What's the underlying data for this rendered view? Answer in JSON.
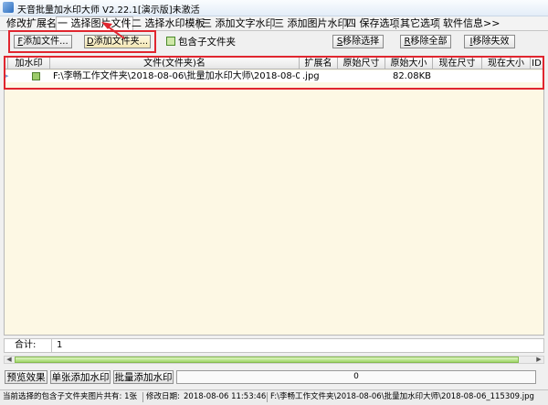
{
  "window": {
    "title": "天音批量加水印大师 V2.22.1[演示版]未激活"
  },
  "tabs": [
    {
      "label": "修改扩展名"
    },
    {
      "label": "一 选择图片文件",
      "active": true
    },
    {
      "label": "二 选择水印模板"
    },
    {
      "label": "三 添加文字水印"
    },
    {
      "label": "三 添加图片水印"
    },
    {
      "label": "四 保存选项"
    },
    {
      "label": "其它选项"
    },
    {
      "label": "软件信息>>"
    }
  ],
  "toolbar": {
    "add_file_key": "F",
    "add_file_label": "添加文件...",
    "add_folder_key": "D",
    "add_folder_label": "添加文件夹...",
    "include_subfolders_label": "包含子文件夹",
    "include_subfolders_checked": true,
    "remove_selected_key": "S",
    "remove_selected_label": "移除选择",
    "remove_all_key": "R",
    "remove_all_label": "移除全部",
    "remove_failed_key": "I",
    "remove_failed_label": "移除失效"
  },
  "grid": {
    "columns": [
      "加水印",
      "文件(文件夹)名",
      "扩展名",
      "原始尺寸",
      "原始大小",
      "现在尺寸",
      "现在大小",
      "ID"
    ],
    "rows": [
      {
        "watermark": true,
        "name": "F:\\李畅工作文件夹\\2018-08-06\\批量加水印大师\\2018-08-06_",
        "ext": ".jpg",
        "orig_dim": "",
        "orig_size": "82.08KB",
        "cur_dim": "",
        "cur_size": "",
        "id": ""
      }
    ]
  },
  "total": {
    "label": "合计:",
    "value": "1"
  },
  "buttons": {
    "preview": "预览效果",
    "single": "单张添加水印",
    "batch": "批量添加水印"
  },
  "progress": {
    "value": 0,
    "text": "0"
  },
  "status": {
    "subfolder_count": "当前选择的包含子文件夹图片共有: 1张",
    "modified_label": "修改日期:",
    "modified_date": "2018-08-06 11:53:46",
    "path": "F:\\李畅工作文件夹\\2018-08-06\\批量加水印大师\\2018-08-06_115309.jpg"
  },
  "colors": {
    "accent_red": "#e0262f",
    "progress_green": "#6fbf4a",
    "grid_bg": "#fdf8e4"
  }
}
